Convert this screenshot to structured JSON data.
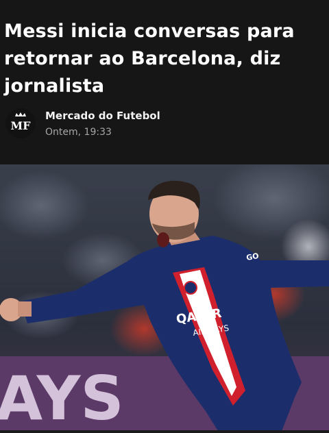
{
  "article": {
    "headline": "Messi inicia conversas para retornar ao Barcelona, diz jornalista",
    "source": {
      "name": "Mercado do Futebol",
      "timestamp": "Ontem, 19:33",
      "logo_text": "MF",
      "logo_icon": "crown-icon"
    }
  },
  "photo": {
    "banner_text": "AYS",
    "jersey_sponsor_line1": "QATAR",
    "jersey_sponsor_line2": "AIRWAYS",
    "sleeve_text": "GO"
  },
  "colors": {
    "background": "#161616",
    "headline": "#ffffff",
    "source_name": "#f2f2f2",
    "timestamp": "#a7a7a7",
    "jersey_navy": "#1c2d6b",
    "jersey_red": "#d0202e"
  }
}
